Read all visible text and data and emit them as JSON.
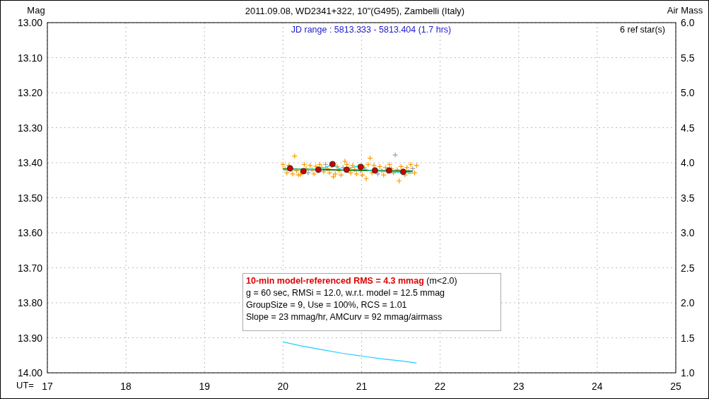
{
  "title": "2011.09.08, WD2341+322, 10\"(G495), Zambelli (Italy)",
  "jd_range": "JD range : 5813.333 - 5813.404 (1.7 hrs)",
  "ref_stars": "6 ref star(s)",
  "stats": {
    "headline": "10-min model-referenced RMS = 4.3 mmag",
    "headline_note": "(m<2.0)",
    "lines": [
      "g = 60 sec, RMSi = 12.0, w.r.t. model = 12.5 mmag",
      "GroupSize = 9, Use = 100%, RCS = 1.01",
      "Slope = 23 mmag/hr, AMCurv = 92 mmag/airmass"
    ]
  },
  "plot": {
    "chart_data": {
      "type": "scatter",
      "ylabel": "Mag",
      "xlabel": "UT=",
      "xlim": [
        17,
        25
      ],
      "ylim": [
        14,
        13
      ],
      "xticks": [
        17,
        18,
        19,
        20,
        21,
        22,
        23,
        24,
        25
      ],
      "yticks": [
        {
          "value": 13,
          "label": "13.00"
        },
        {
          "value": 13.1,
          "label": "13.10"
        },
        {
          "value": 13.2,
          "label": "13.20"
        },
        {
          "value": 13.3,
          "label": "13.30"
        },
        {
          "value": 13.4,
          "label": "13.40"
        },
        {
          "value": 13.5,
          "label": "13.50"
        },
        {
          "value": 13.6,
          "label": "13.60"
        },
        {
          "value": 13.7,
          "label": "13.70"
        },
        {
          "value": 13.8,
          "label": "13.80"
        },
        {
          "value": 13.9,
          "label": "13.90"
        },
        {
          "value": 14,
          "label": "14.00"
        }
      ],
      "x": [
        20.09,
        20.26,
        20.45,
        20.63,
        20.81,
        20.99,
        21.17,
        21.35,
        21.53
      ],
      "series": [
        {
          "color": "#cc0000",
          "values": [
            13.416,
            13.424,
            13.42,
            13.404,
            13.42,
            13.412,
            13.422,
            13.422,
            13.426
          ]
        }
      ]
    }
  },
  "airmass": {
    "chart_data": {
      "type": "line",
      "ylabel": "Air Mass",
      "xlim": [
        17,
        25
      ],
      "ylim": [
        1,
        6
      ],
      "yticks": [
        {
          "value": 6,
          "label": "6.0"
        },
        {
          "value": 5.5,
          "label": "5.5"
        },
        {
          "value": 5,
          "label": "5.0"
        },
        {
          "value": 4.5,
          "label": "4.5"
        },
        {
          "value": 4,
          "label": "4.0"
        },
        {
          "value": 3.5,
          "label": "3.5"
        },
        {
          "value": 3,
          "label": "3.0"
        },
        {
          "value": 2.5,
          "label": "2.5"
        },
        {
          "value": 2,
          "label": "2.0"
        },
        {
          "value": 1.5,
          "label": "1.5"
        },
        {
          "value": 1,
          "label": "1.0"
        }
      ],
      "x": [
        20.0,
        20.25,
        20.5,
        20.75,
        21.0,
        21.25,
        21.5,
        21.7
      ],
      "series": [
        {
          "color": "#22ccff",
          "values": [
            1.44,
            1.38,
            1.33,
            1.28,
            1.24,
            1.2,
            1.17,
            1.14
          ]
        }
      ]
    }
  }
}
